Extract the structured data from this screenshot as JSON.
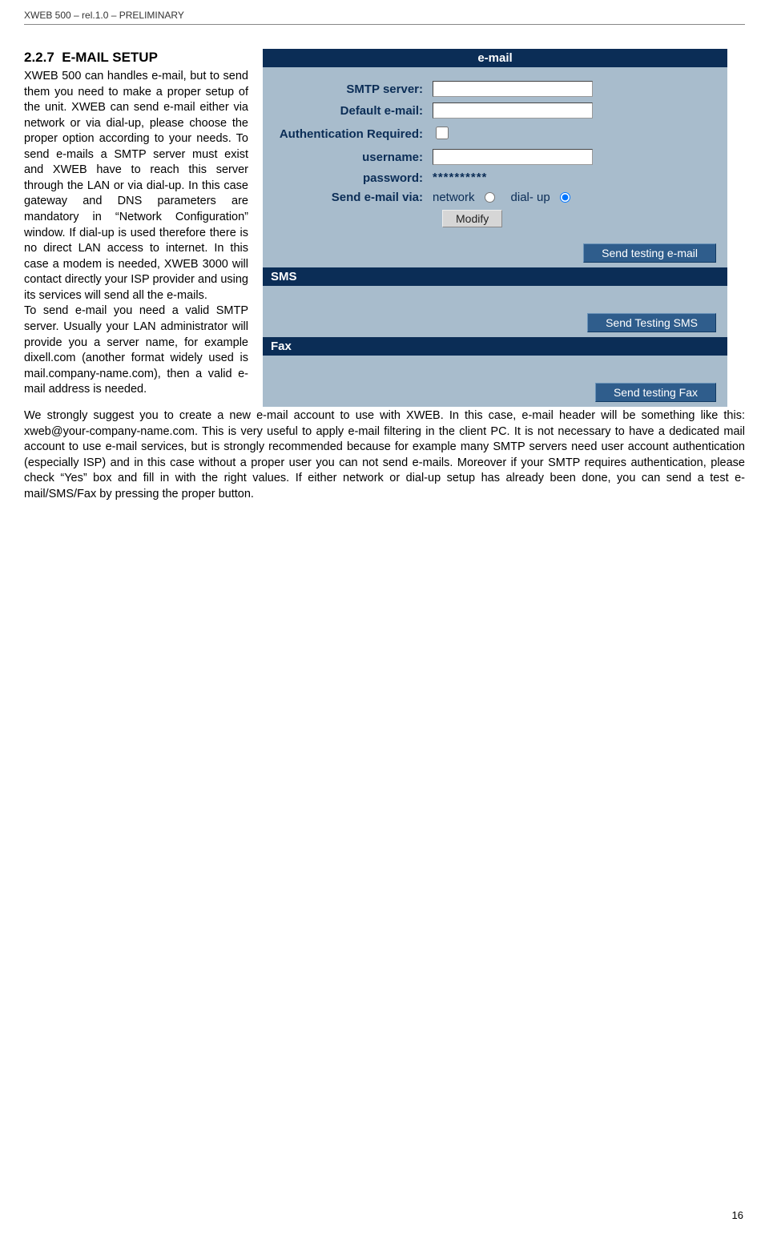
{
  "doc_header": "XWEB 500 – rel.1.0 – PRELIMINARY",
  "page_number": "16",
  "section": {
    "number": "2.2.7",
    "title": "E-MAIL SETUP",
    "para_left": "XWEB 500 can handles e-mail, but to send them you need to make a proper setup of the unit. XWEB can send e-mail either via network or via dial-up, please choose the proper option according to your needs. To send e-mails a SMTP server must exist and XWEB have to reach this server through the LAN or via dial-up. In this case gateway and DNS parameters are mandatory in “Network Configuration” window. If dial-up is used therefore there is no direct LAN access to internet. In this case a modem is needed, XWEB 3000 will contact directly your ISP provider and using its services will send all the e-mails.\nTo send e-mail you need a valid SMTP server. Usually your LAN administrator will provide you a server name, for example dixell.com (another format widely used is mail.company-name.com), then a valid e-mail address is needed.",
    "para_below": "We strongly suggest you to create a new e-mail account to use with XWEB. In this case, e-mail header will be something like this: xweb@your-company-name.com. This is very useful to apply e-mail filtering in the client PC. It is not necessary to have a dedicated mail account to use e-mail services, but is strongly recommended because for example many SMTP servers need user account authentication (especially ISP) and in this case without a proper user you can not send e-mails. Moreover if your SMTP requires authentication, please check “Yes” box and fill in with the right values. If either network or dial-up setup has already been done, you can send a test e-mail/SMS/Fax by pressing the proper button."
  },
  "panel": {
    "email": {
      "title": "e-mail",
      "smtp_label": "SMTP server:",
      "smtp_value": "",
      "default_label": "Default e-mail:",
      "default_value": "",
      "auth_label": "Authentication Required:",
      "auth_checked": false,
      "user_label": "username:",
      "user_value": "",
      "pass_label": "password:",
      "pass_value": "**********",
      "sendvia_label": "Send e-mail via:",
      "opt_network": "network",
      "opt_dialup": "dial- up",
      "selected": "dialup",
      "modify_btn": "Modify",
      "test_btn": "Send testing e-mail"
    },
    "sms": {
      "title": "SMS",
      "test_btn": "Send Testing SMS"
    },
    "fax": {
      "title": "Fax",
      "test_btn": "Send testing Fax"
    }
  }
}
